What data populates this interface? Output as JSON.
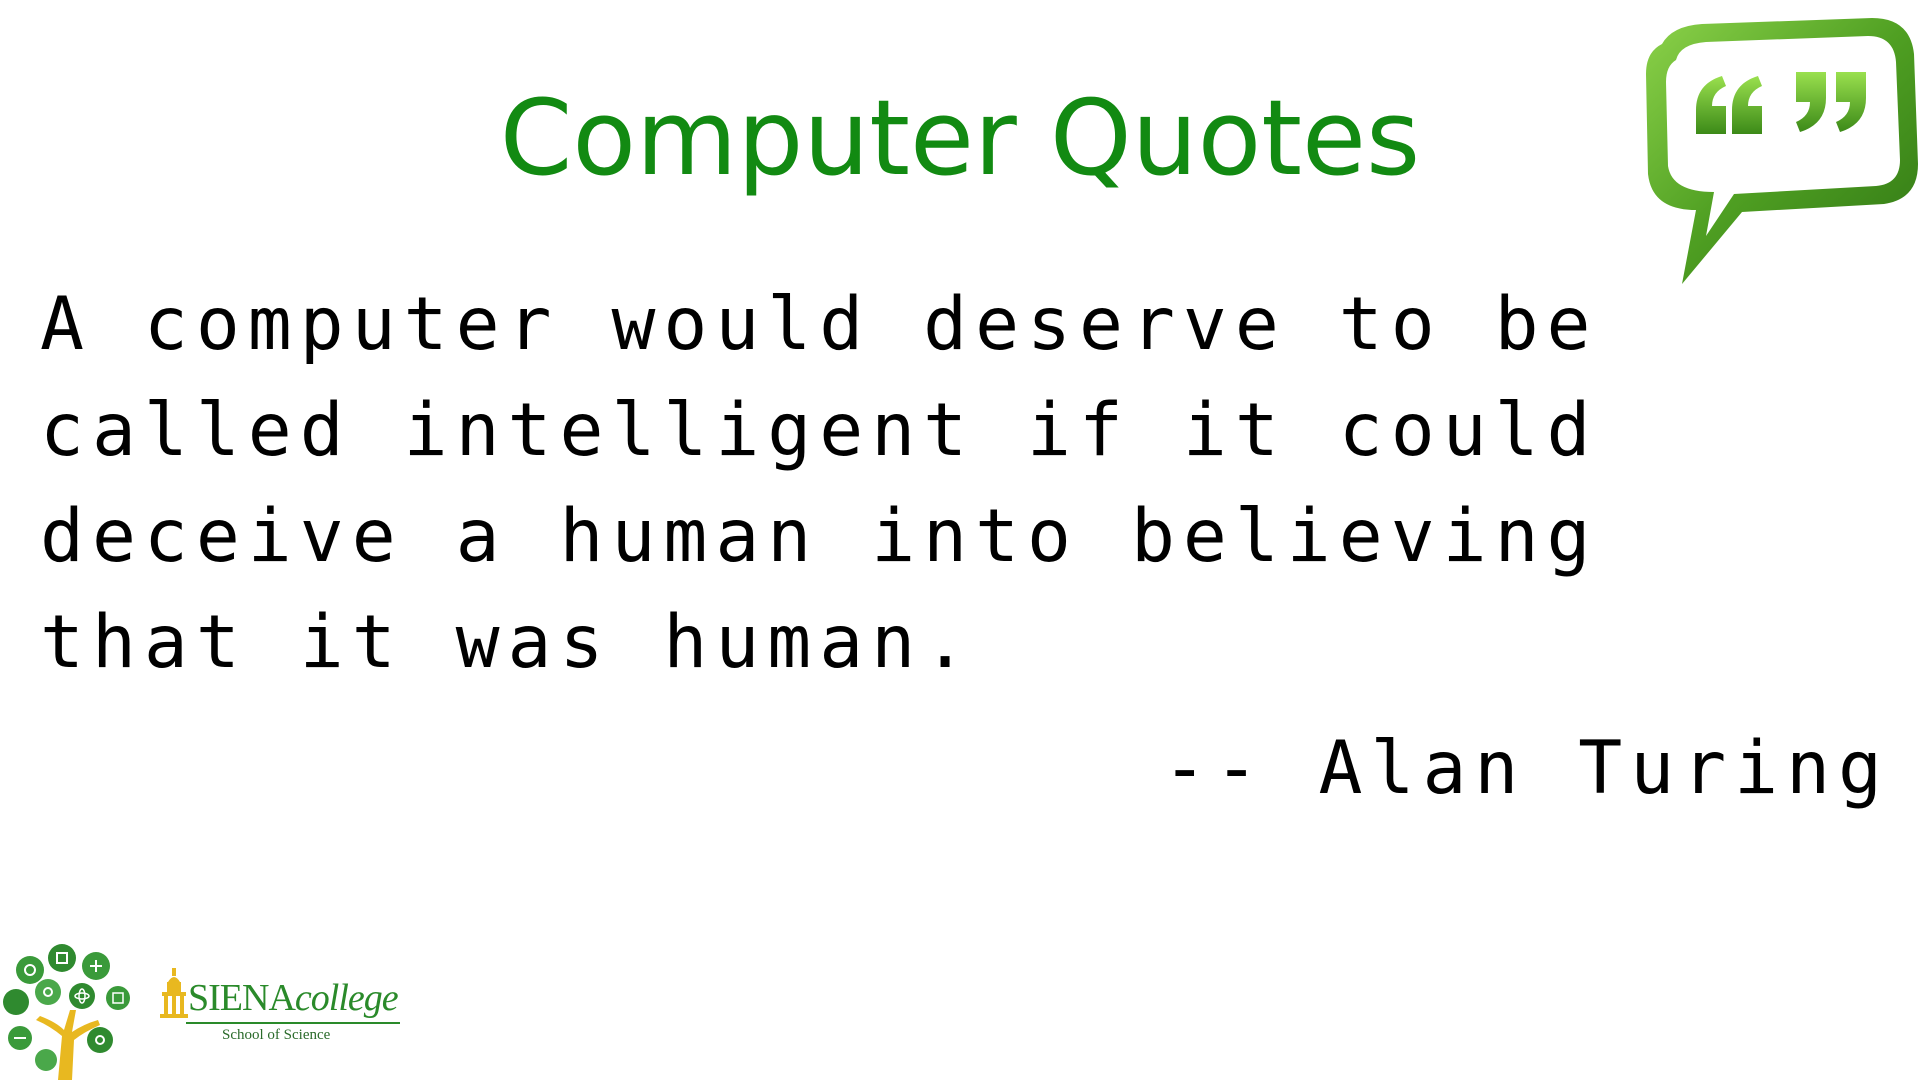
{
  "slide": {
    "title": "Computer Quotes",
    "quote_lines": [
      "A computer would deserve to be",
      "called intelligent if it could",
      "deceive a human into believing",
      "that it was human."
    ],
    "attribution": "-- Alan Turing"
  },
  "icons": {
    "quote_bubble": "speech-bubble-quote-icon",
    "tree_logo": "science-tree-logo",
    "college_logo": "siena-college-logo"
  },
  "logo": {
    "siena_main": "SIENA",
    "siena_college": "college",
    "school": "School of Science"
  },
  "colors": {
    "title": "#128a12",
    "text": "#000000",
    "icon_green": "#5aa52a",
    "logo_green": "#2a8a2a",
    "logo_gold": "#e8b820"
  }
}
